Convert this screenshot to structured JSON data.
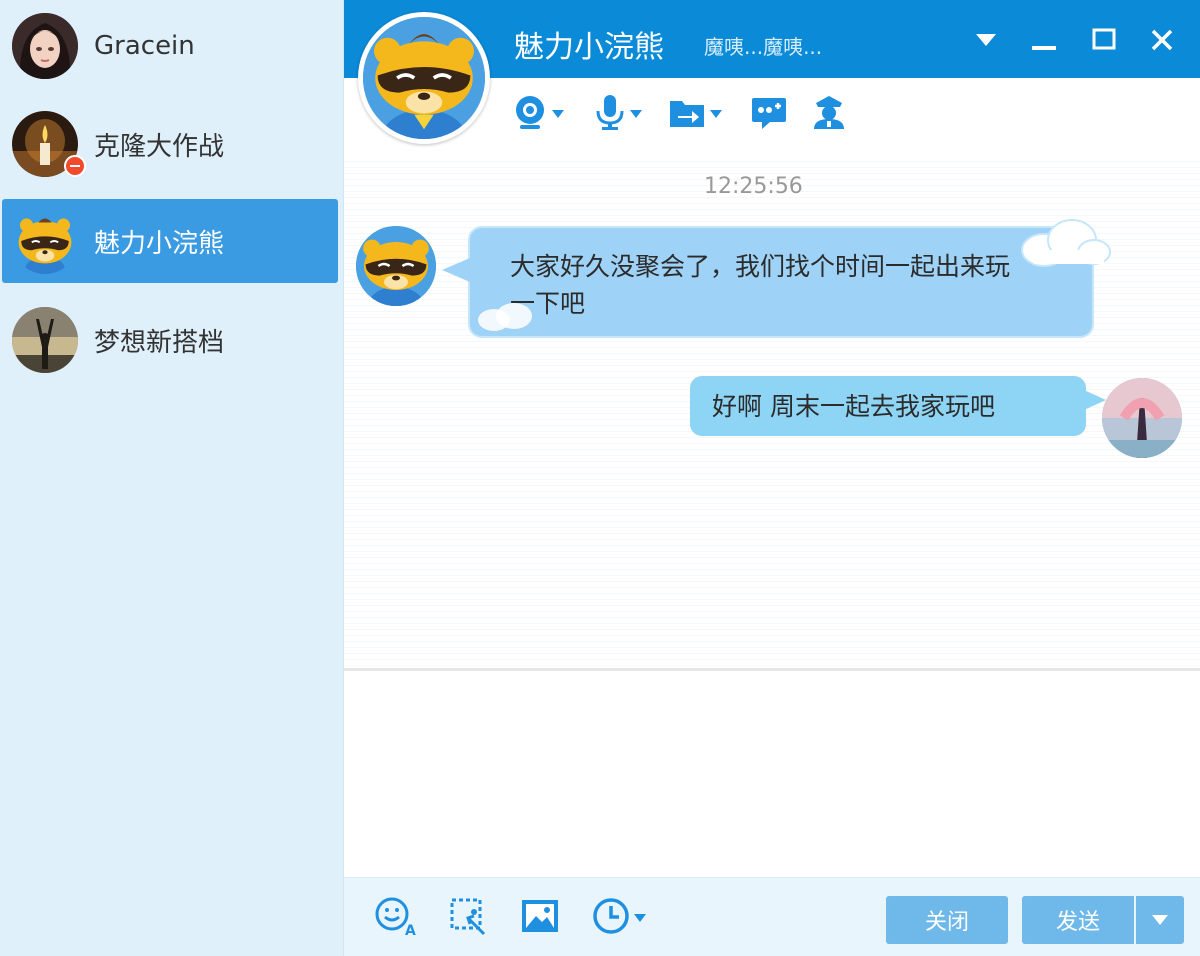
{
  "sidebar": {
    "contacts": [
      {
        "name": "Gracein",
        "avatar": "girl-portrait"
      },
      {
        "name": "克隆大作战",
        "avatar": "candle-photo",
        "badge": "minus-badge"
      },
      {
        "name": "魅力小浣熊",
        "avatar": "raccoon-mascot",
        "active": true
      },
      {
        "name": "梦想新搭档",
        "avatar": "silhouette-sunset"
      }
    ]
  },
  "header": {
    "title": "魅力小浣熊",
    "status": "魔咦...魔咦...",
    "window_controls": [
      "dropdown-icon",
      "minimize-icon",
      "maximize-icon",
      "close-icon"
    ]
  },
  "toolbar": {
    "items": [
      "video-call-icon",
      "voice-call-icon",
      "file-transfer-icon",
      "remote-assist-icon",
      "security-icon"
    ]
  },
  "chat": {
    "timestamp": "12:25:56",
    "messages": [
      {
        "direction": "incoming",
        "text": "大家好久没聚会了，我们找个时间一起出来玩一下吧"
      },
      {
        "direction": "outgoing",
        "text": "好啊 周末一起去我家玩吧"
      }
    ]
  },
  "bottom": {
    "tools": [
      "emoji-font-icon",
      "screenshot-icon",
      "image-icon",
      "history-icon"
    ],
    "close_label": "关闭",
    "send_label": "发送"
  },
  "colors": {
    "accent": "#0b8ad8",
    "active_contact": "#3a9be3",
    "incoming_bubble": "#9fd2f7",
    "outgoing_bubble": "#8ed4f4",
    "button": "#6fb9ea"
  }
}
